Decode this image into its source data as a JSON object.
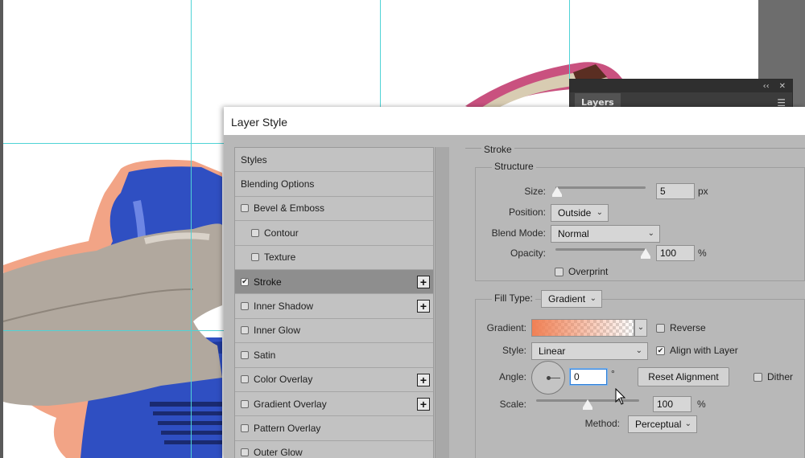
{
  "layers_panel": {
    "collapse_icon": "double-chevron-left-icon",
    "close_icon": "close-icon",
    "tab_label": "Layers",
    "menu_icon": "hamburger-menu-icon"
  },
  "dialog": {
    "title": "Layer Style",
    "styles": [
      {
        "label": "Styles",
        "checkbox": false,
        "checked": false,
        "indent": false,
        "plus": false,
        "selected": false
      },
      {
        "label": "Blending Options",
        "checkbox": false,
        "checked": false,
        "indent": false,
        "plus": false,
        "selected": false
      },
      {
        "label": "Bevel & Emboss",
        "checkbox": true,
        "checked": false,
        "indent": false,
        "plus": false,
        "selected": false
      },
      {
        "label": "Contour",
        "checkbox": true,
        "checked": false,
        "indent": true,
        "plus": false,
        "selected": false
      },
      {
        "label": "Texture",
        "checkbox": true,
        "checked": false,
        "indent": true,
        "plus": false,
        "selected": false
      },
      {
        "label": "Stroke",
        "checkbox": true,
        "checked": true,
        "indent": false,
        "plus": true,
        "selected": true
      },
      {
        "label": "Inner Shadow",
        "checkbox": true,
        "checked": false,
        "indent": false,
        "plus": true,
        "selected": false
      },
      {
        "label": "Inner Glow",
        "checkbox": true,
        "checked": false,
        "indent": false,
        "plus": false,
        "selected": false
      },
      {
        "label": "Satin",
        "checkbox": true,
        "checked": false,
        "indent": false,
        "plus": false,
        "selected": false
      },
      {
        "label": "Color Overlay",
        "checkbox": true,
        "checked": false,
        "indent": false,
        "plus": true,
        "selected": false
      },
      {
        "label": "Gradient Overlay",
        "checkbox": true,
        "checked": false,
        "indent": false,
        "plus": true,
        "selected": false
      },
      {
        "label": "Pattern Overlay",
        "checkbox": true,
        "checked": false,
        "indent": false,
        "plus": false,
        "selected": false
      },
      {
        "label": "Outer Glow",
        "checkbox": true,
        "checked": false,
        "indent": false,
        "plus": false,
        "selected": false
      }
    ],
    "stroke": {
      "section_title": "Stroke",
      "structure_title": "Structure",
      "size_label": "Size:",
      "size_value": "5",
      "size_unit": "px",
      "size_slider_fraction": 0.02,
      "position_label": "Position:",
      "position_value": "Outside",
      "blend_mode_label": "Blend Mode:",
      "blend_mode_value": "Normal",
      "opacity_label": "Opacity:",
      "opacity_value": "100",
      "opacity_unit": "%",
      "opacity_slider_fraction": 1.0,
      "overprint_label": "Overprint",
      "overprint_checked": false,
      "fill_type_label": "Fill Type:",
      "fill_type_value": "Gradient",
      "gradient_label": "Gradient:",
      "gradient_start_color": "#f08054",
      "reverse_label": "Reverse",
      "reverse_checked": false,
      "style_label": "Style:",
      "style_value": "Linear",
      "align_label": "Align with Layer",
      "align_checked": true,
      "angle_label": "Angle:",
      "angle_value": "0",
      "angle_unit": "°",
      "reset_alignment_label": "Reset Alignment",
      "dither_label": "Dither",
      "dither_checked": false,
      "scale_label": "Scale:",
      "scale_value": "100",
      "scale_unit": "%",
      "scale_slider_fraction": 0.5,
      "method_label": "Method:",
      "method_value": "Perceptual"
    }
  },
  "canvas": {
    "background_color": "#ffffff",
    "guide_color": "#4fd3d6",
    "bottle_color": "#2f4fc2",
    "stroke_color": "#f08054"
  }
}
